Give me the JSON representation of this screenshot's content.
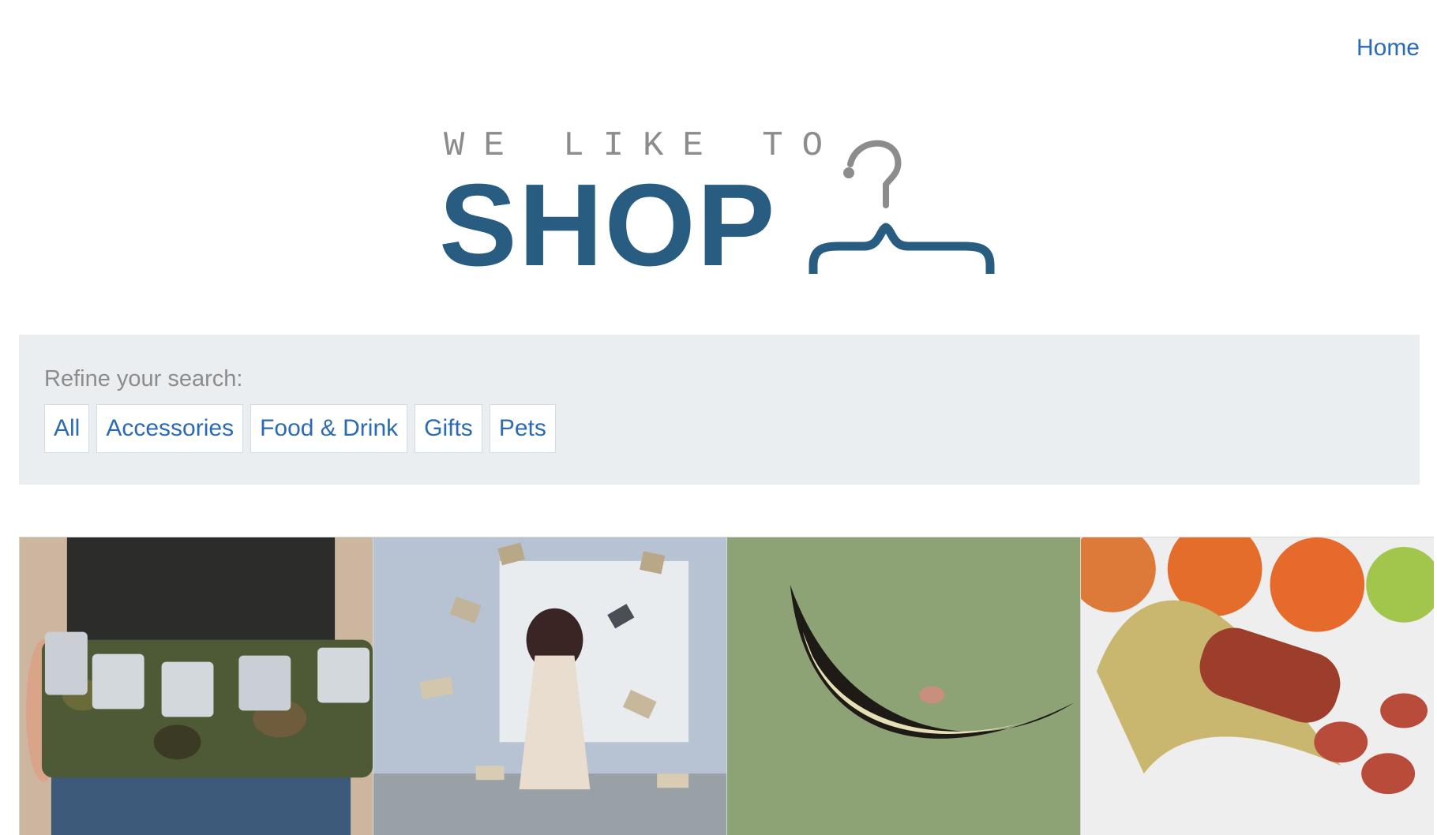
{
  "nav": {
    "home_label": "Home"
  },
  "logo": {
    "tagline": "WE LIKE TO",
    "word": "SHOP",
    "icon": "hanger-icon",
    "colors": {
      "tagline": "#8c8c8c",
      "word": "#285c80"
    }
  },
  "filters": {
    "label": "Refine your search:",
    "options": [
      "All",
      "Accessories",
      "Food & Drink",
      "Gifts",
      "Pets"
    ]
  },
  "products": [
    {
      "image": "beer-can-belt-photo"
    },
    {
      "image": "flying-books-photo"
    },
    {
      "image": "cheshire-cat-grin-photo"
    },
    {
      "image": "sausage-banana-photo"
    }
  ],
  "colors": {
    "link": "#2a6bb3",
    "panel": "#ebeef1",
    "brand": "#285c80"
  }
}
